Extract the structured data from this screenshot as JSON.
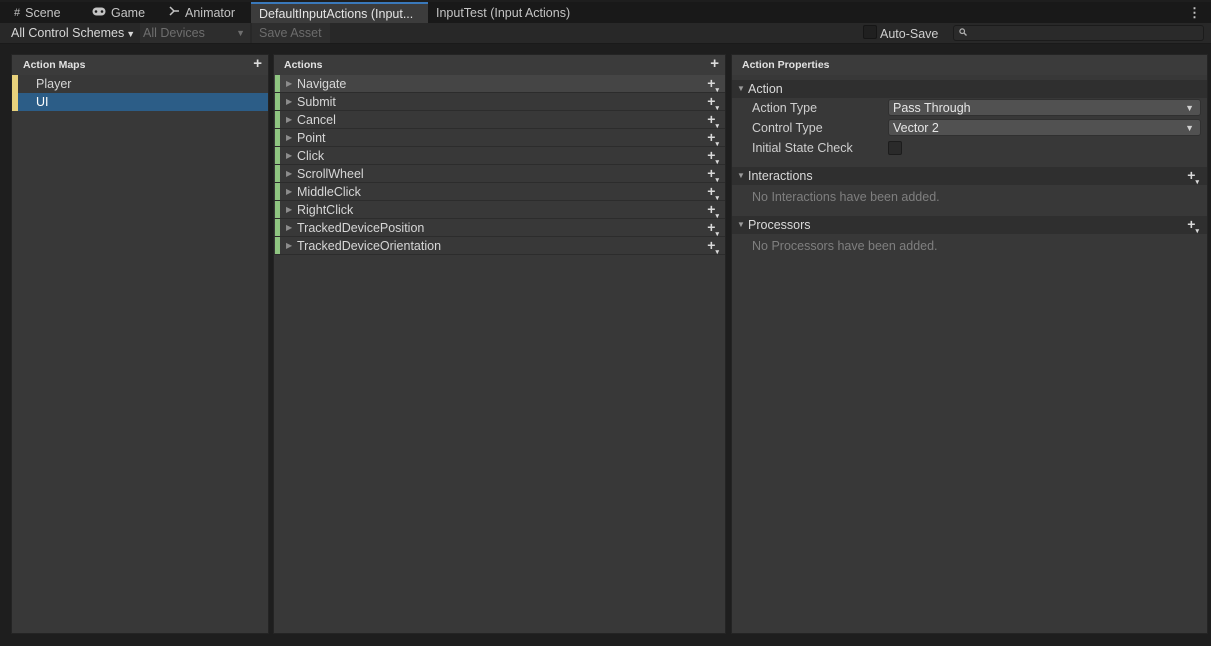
{
  "tabs": [
    {
      "label": "Scene",
      "icon": "grid-icon"
    },
    {
      "label": "Game",
      "icon": "gamepad-icon"
    },
    {
      "label": "Animator",
      "icon": "animator-icon"
    },
    {
      "label": "DefaultInputActions (Input...",
      "active": true
    },
    {
      "label": "InputTest (Input Actions)"
    }
  ],
  "tab_menu_icon": "kebab-menu-icon",
  "toolbar": {
    "control_schemes": "All Control Schemes",
    "devices": "All Devices",
    "save_asset": "Save Asset",
    "auto_save_label": "Auto-Save",
    "auto_save_checked": false,
    "search_value": "",
    "search_icon": "search-icon"
  },
  "action_maps": {
    "header": "Action Maps",
    "items": [
      {
        "label": "Player",
        "selected": false
      },
      {
        "label": "UI",
        "selected": true
      }
    ],
    "stripe_color": "#e8d27c"
  },
  "actions": {
    "header": "Actions",
    "stripe_color": "#8fc581",
    "items": [
      "Navigate",
      "Submit",
      "Cancel",
      "Point",
      "Click",
      "ScrollWheel",
      "MiddleClick",
      "RightClick",
      "TrackedDevicePosition",
      "TrackedDeviceOrientation"
    ]
  },
  "properties": {
    "header": "Action Properties",
    "action_section": "Action",
    "action_type_label": "Action Type",
    "action_type_value": "Pass Through",
    "control_type_label": "Control Type",
    "control_type_value": "Vector 2",
    "initial_state_label": "Initial State Check",
    "initial_state_checked": false,
    "interactions_section": "Interactions",
    "interactions_empty": "No Interactions have been added.",
    "processors_section": "Processors",
    "processors_empty": "No Processors have been added."
  },
  "colors": {
    "selection": "#2c5d87",
    "active_tab_accent": "#3a79bb"
  }
}
